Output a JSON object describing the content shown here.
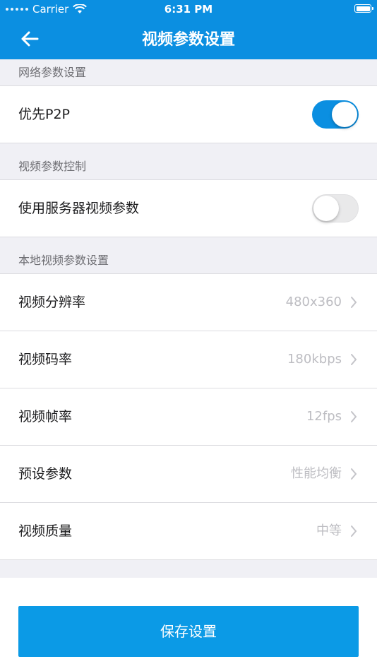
{
  "status_bar": {
    "carrier": "Carrier",
    "time": "6:31 PM"
  },
  "nav": {
    "title": "视频参数设置",
    "back_icon": "arrow-left-icon"
  },
  "sections": {
    "network": {
      "header": "网络参数设置",
      "p2p": {
        "label": "优先P2P",
        "enabled": true
      }
    },
    "control": {
      "header": "视频参数控制",
      "server_params": {
        "label": "使用服务器视频参数",
        "enabled": false
      }
    },
    "local": {
      "header": "本地视频参数设置",
      "items": [
        {
          "label": "视频分辨率",
          "value": "480x360"
        },
        {
          "label": "视频码率",
          "value": "180kbps"
        },
        {
          "label": "视频帧率",
          "value": "12fps"
        },
        {
          "label": "预设参数",
          "value": "性能均衡"
        },
        {
          "label": "视频质量",
          "value": "中等"
        }
      ]
    }
  },
  "save_button": {
    "label": "保存设置"
  },
  "colors": {
    "accent": "#0b8fe1",
    "button": "#0b9ae6",
    "background": "#f0f0f5"
  }
}
